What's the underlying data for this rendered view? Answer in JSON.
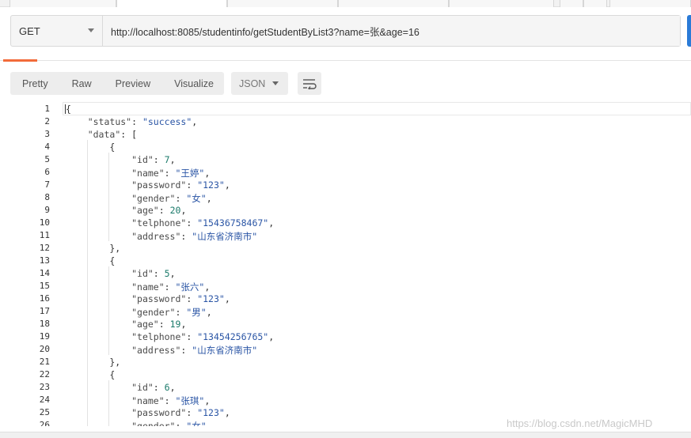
{
  "request": {
    "method": "GET",
    "url": "http://localhost:8085/studentinfo/getStudentByList3?name=张&age=16"
  },
  "response_toolbar": {
    "views": [
      "Pretty",
      "Raw",
      "Preview",
      "Visualize"
    ],
    "format": "JSON"
  },
  "code_lines": [
    "{",
    "    \"status\": \"success\",",
    "    \"data\": [",
    "        {",
    "            \"id\": 7,",
    "            \"name\": \"王婷\",",
    "            \"password\": \"123\",",
    "            \"gender\": \"女\",",
    "            \"age\": 20,",
    "            \"telphone\": \"15436758467\",",
    "            \"address\": \"山东省济南市\"",
    "        },",
    "        {",
    "            \"id\": 5,",
    "            \"name\": \"张六\",",
    "            \"password\": \"123\",",
    "            \"gender\": \"男\",",
    "            \"age\": 19,",
    "            \"telphone\": \"13454256765\",",
    "            \"address\": \"山东省济南市\"",
    "        },",
    "        {",
    "            \"id\": 6,",
    "            \"name\": \"张琪\",",
    "            \"password\": \"123\",",
    "            \"gender\": \"女\","
  ],
  "watermark": "https://blog.csdn.net/MagicMHD"
}
